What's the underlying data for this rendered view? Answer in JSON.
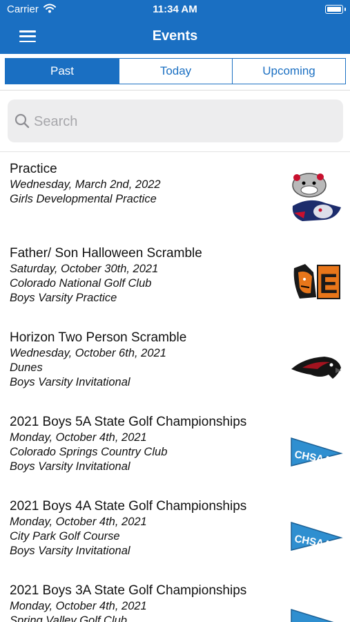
{
  "status_bar": {
    "carrier": "Carrier",
    "time": "11:34 AM"
  },
  "header": {
    "title": "Events"
  },
  "tabs": [
    {
      "label": "Past",
      "active": true
    },
    {
      "label": "Today",
      "active": false
    },
    {
      "label": "Upcoming",
      "active": false
    }
  ],
  "search": {
    "placeholder": "Search",
    "value": ""
  },
  "events": [
    {
      "title": "Practice",
      "date": "Wednesday, March 2nd, 2022",
      "lines": [
        "Girls Developmental Practice"
      ],
      "logo": "bulldog-vs-mascot-logo"
    },
    {
      "title": "Father/ Son Halloween Scramble",
      "date": "Saturday, October 30th, 2021",
      "lines": [
        "Colorado National Golf Club",
        "Boys Varsity Practice"
      ],
      "logo": "tiger-e-logo"
    },
    {
      "title": "Horizon Two Person Scramble",
      "date": "Wednesday, October 6th, 2021",
      "lines": [
        "Dunes",
        "Boys Varsity Invitational"
      ],
      "logo": "hawk-logo"
    },
    {
      "title": "2021 Boys 5A State Golf Championships",
      "date": "Monday, October 4th, 2021",
      "lines": [
        "Colorado Springs Country Club",
        "Boys Varsity Invitational"
      ],
      "logo": "chsaa-pennant-logo"
    },
    {
      "title": "2021 Boys 4A State Golf Championships",
      "date": "Monday, October 4th, 2021",
      "lines": [
        "City Park Golf Course",
        "Boys Varsity Invitational"
      ],
      "logo": "chsaa-pennant-logo"
    },
    {
      "title": "2021 Boys 3A State Golf Championships",
      "date": "Monday, October 4th, 2021",
      "lines": [
        "Spring Valley Golf Club"
      ],
      "logo": "chsaa-pennant-logo"
    }
  ],
  "logo_text": {
    "chsaa": "CHSAA",
    "tiger_letter": "E"
  },
  "colors": {
    "primary": "#1a6fc2",
    "pennant": "#2f8fd0"
  }
}
